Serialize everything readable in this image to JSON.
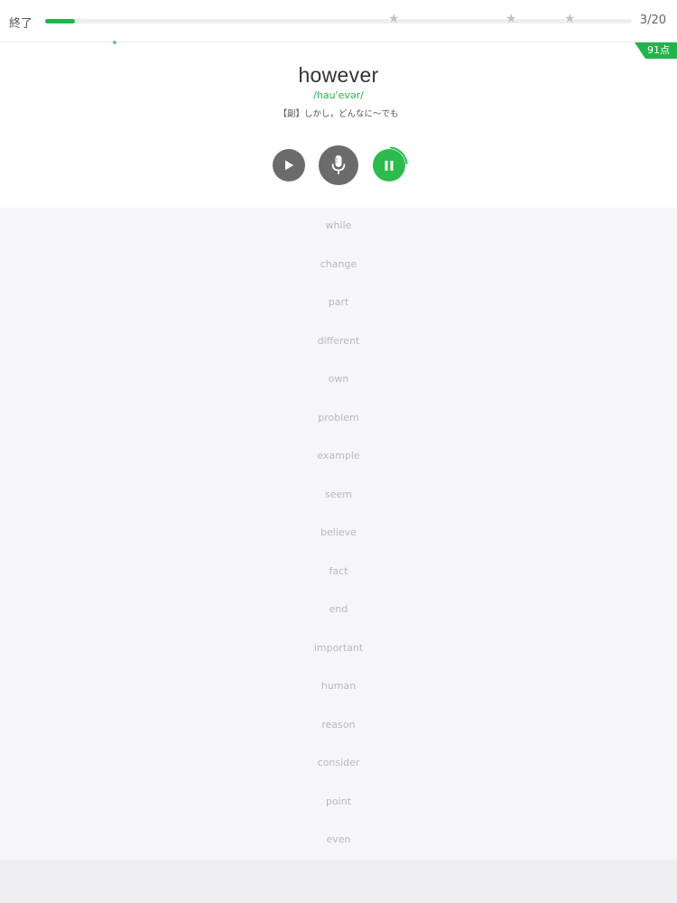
{
  "header": {
    "end_label": "終了",
    "progress": 0.05,
    "stars": [
      "★",
      "★",
      "★"
    ],
    "counter": "3/20"
  },
  "score_badge": "91点",
  "card": {
    "word": "however",
    "phonetic": "/hau'evər/",
    "meaning": "【副】しかし，どんなに～でも"
  },
  "controls": {
    "play_icon": "play-icon",
    "mic_icon": "mic-icon",
    "pause_icon": "pause-icon"
  },
  "word_list": [
    "while",
    "change",
    "part",
    "different",
    "own",
    "problem",
    "example",
    "seem",
    "believe",
    "fact",
    "end",
    "important",
    "human",
    "reason",
    "consider",
    "point",
    "even"
  ],
  "colors": {
    "accent": "#22b34a",
    "button_dark": "#6b6b6b"
  }
}
